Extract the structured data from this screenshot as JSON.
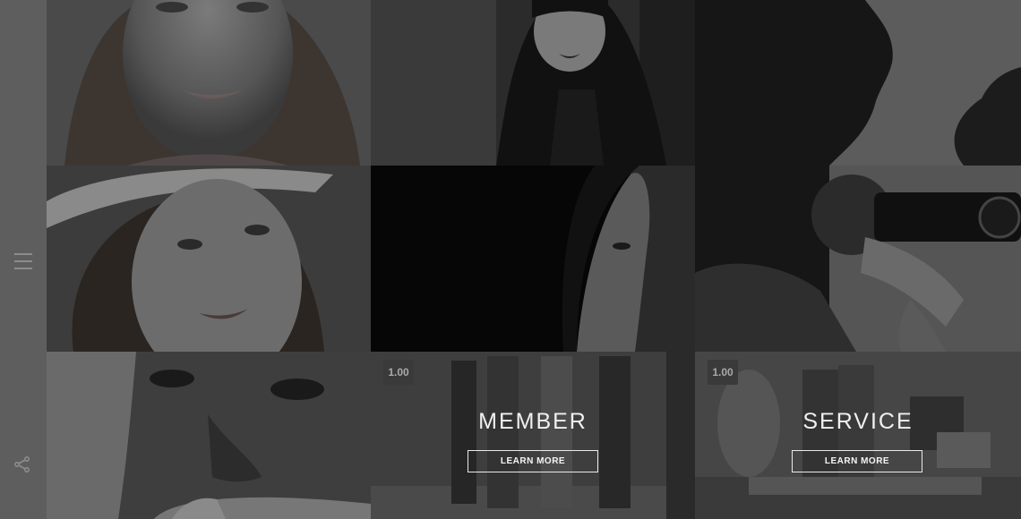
{
  "sidebar": {
    "menu_icon": "hamburger-menu-icon",
    "share_icon": "share-icon"
  },
  "tiles": [
    {
      "subject": "smiling woman portrait"
    },
    {
      "subject": "woman with dark hair"
    },
    {
      "subject": "man silhouette profile"
    },
    {
      "subject": "woman with straw hat"
    },
    {
      "subject": "girl profile in shadow"
    },
    {
      "subject": "photographer with camera"
    },
    {
      "subject": "crying face close-up"
    },
    {
      "badge": "1.00",
      "title": "MEMBER",
      "button": "LEARN MORE"
    },
    {
      "badge": "1.00",
      "title": "SERVICE",
      "button": "LEARN MORE"
    }
  ],
  "colors": {
    "sidebar": "#5e5e5e",
    "overlay_text": "#f0f0f0"
  }
}
